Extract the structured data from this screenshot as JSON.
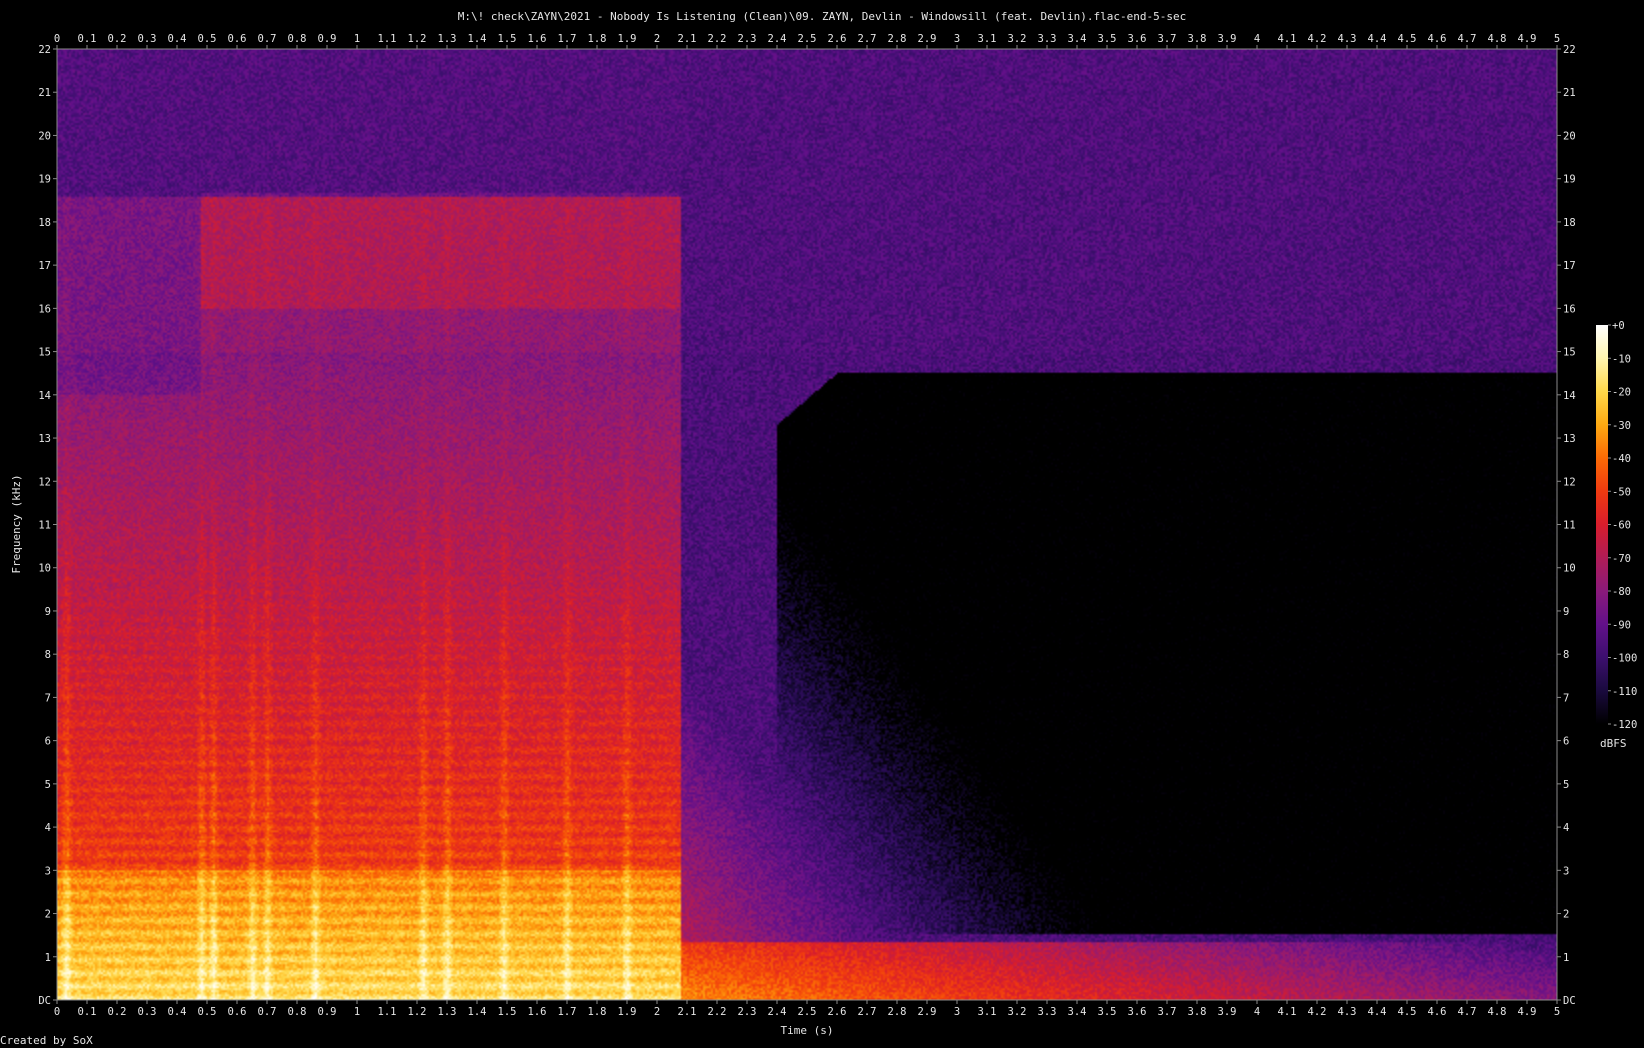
{
  "chart_data": {
    "type": "heatmap",
    "title": "M:\\! check\\ZAYN\\2021 - Nobody Is Listening (Clean)\\09. ZAYN, Devlin - Windowsill (feat. Devlin).flac-end-5-sec",
    "xlabel": "Time (s)",
    "ylabel": "Frequency (kHz)",
    "footer": "Created by SoX",
    "x_range": [
      0,
      5
    ],
    "y_range": [
      0,
      22
    ],
    "x_ticks": [
      "0",
      "0.1",
      "0.2",
      "0.3",
      "0.4",
      "0.5",
      "0.6",
      "0.7",
      "0.8",
      "0.9",
      "1",
      "1.1",
      "1.2",
      "1.3",
      "1.4",
      "1.5",
      "1.6",
      "1.7",
      "1.8",
      "1.9",
      "2",
      "2.1",
      "2.2",
      "2.3",
      "2.4",
      "2.5",
      "2.6",
      "2.7",
      "2.8",
      "2.9",
      "3",
      "3.1",
      "3.2",
      "3.3",
      "3.4",
      "3.5",
      "3.6",
      "3.7",
      "3.8",
      "3.9",
      "4",
      "4.1",
      "4.2",
      "4.3",
      "4.4",
      "4.5",
      "4.6",
      "4.7",
      "4.8",
      "4.9",
      "5"
    ],
    "y_ticks": [
      "DC",
      "1",
      "2",
      "3",
      "4",
      "5",
      "6",
      "7",
      "8",
      "9",
      "10",
      "11",
      "12",
      "13",
      "14",
      "15",
      "16",
      "17",
      "18",
      "19",
      "20",
      "21",
      "22"
    ],
    "colorbar": {
      "unit": "dBFS",
      "ticks": [
        "+0",
        "-10",
        "-20",
        "-30",
        "-40",
        "-50",
        "-60",
        "-70",
        "-80",
        "-90",
        "-100",
        "-110",
        "-120"
      ],
      "range": [
        -120,
        0
      ],
      "stops": [
        "#000000",
        "#1a0a3e",
        "#3c0f6e",
        "#62108a",
        "#8a1a7a",
        "#b01c56",
        "#d81d2c",
        "#f03a10",
        "#fb6a05",
        "#feaa12",
        "#ffd84a",
        "#fff5b0",
        "#ffffff"
      ]
    },
    "content_regions": [
      {
        "time_s": [
          0,
          2.1
        ],
        "freq_khz": [
          0,
          18.5
        ],
        "level_db": "-30 to -60",
        "note": "music: dense harmonics, strongest below 3 kHz"
      },
      {
        "time_s": [
          2.1,
          5
        ],
        "freq_khz": [
          0,
          1.2
        ],
        "level_db": "-50 to -80",
        "note": "decaying low-frequency tail"
      },
      {
        "time_s": [
          2.6,
          5
        ],
        "freq_khz": [
          1.5,
          14.5
        ],
        "level_db": "below -110",
        "note": "near silence"
      },
      {
        "time_s": [
          0,
          5
        ],
        "freq_khz": [
          15,
          22
        ],
        "level_db": "-90 to -100",
        "note": "noise floor"
      }
    ]
  }
}
